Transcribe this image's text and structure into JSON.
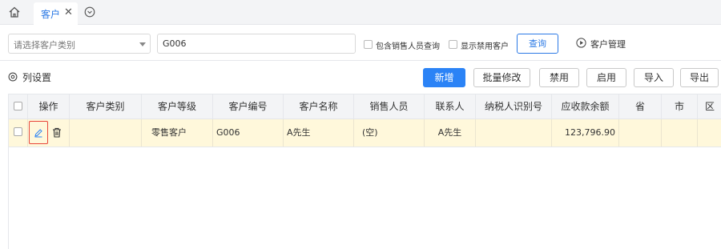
{
  "tabs": {
    "active_label": "客户",
    "close_symbol": "✕"
  },
  "filter": {
    "category_placeholder": "请选择客户类别",
    "search_value": "G006",
    "include_sales_label": "包含销售人员查询",
    "show_disabled_label": "显示禁用客户",
    "query_label": "查询",
    "customer_mgmt_label": "客户管理"
  },
  "toolbar": {
    "column_settings_label": "列设置",
    "add_label": "新增",
    "batch_edit_label": "批量修改",
    "disable_label": "禁用",
    "enable_label": "启用",
    "import_label": "导入",
    "export_label": "导出"
  },
  "table": {
    "headers": [
      "操作",
      "客户类别",
      "客户等级",
      "客户编号",
      "客户名称",
      "销售人员",
      "联系人",
      "纳税人识别号",
      "应收款余额",
      "省",
      "市",
      "区"
    ],
    "rows": [
      {
        "category": "",
        "level": "零售客户",
        "code": "G006",
        "name": "A先生",
        "sales": "(空)",
        "contact": "A先生",
        "tax_id": "",
        "receivable": "123,796.90",
        "province": "",
        "city": "",
        "district": ""
      }
    ]
  },
  "colors": {
    "accent": "#2b83f6",
    "row_highlight": "#fff8db",
    "edit_highlight": "#e8473b"
  }
}
